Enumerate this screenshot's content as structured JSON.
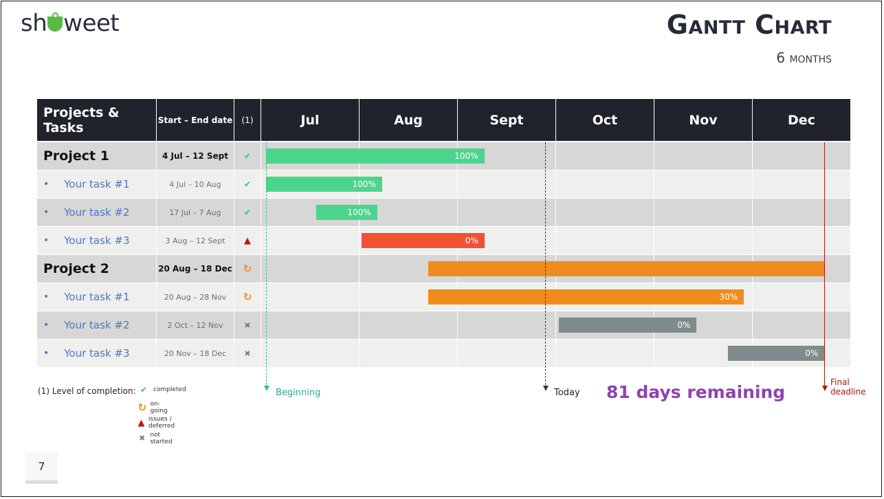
{
  "header": {
    "logo_text": [
      "sh",
      "weet"
    ],
    "title": "Gantt Chart",
    "subtitle": "6 months"
  },
  "table": {
    "col_projects": "Projects & Tasks",
    "col_dates": "Start – End date",
    "col_status": "(1)",
    "months": [
      "Jul",
      "Aug",
      "Sept",
      "Oct",
      "Nov",
      "Dec"
    ]
  },
  "colors": {
    "completed": "#4cd48c",
    "ongoing": "#f08c1e",
    "issues": "#ef5135",
    "not_started": "#7f8b8c",
    "header_bg": "#20232b",
    "row_dark": "#d6d7d6",
    "row_light": "#efefed",
    "beginning": "#2ec27e",
    "today": "#333843",
    "deadline": "#b3140e",
    "remaining": "#8e44ad"
  },
  "chart_data": {
    "type": "gantt",
    "title": "Gantt Chart",
    "subtitle": "6 months",
    "x_axis": {
      "unit": "month",
      "categories": [
        "Jul",
        "Aug",
        "Sept",
        "Oct",
        "Nov",
        "Dec"
      ],
      "range": [
        0,
        6
      ]
    },
    "rows": [
      {
        "kind": "project",
        "name": "Project 1",
        "dates": "4 Jul – 12 Sept",
        "status": "completed",
        "start": 0.05,
        "end": 2.27,
        "progress_label": "100%",
        "bar_color": "completed"
      },
      {
        "kind": "task",
        "name": "Your task #1",
        "dates": "4 Jul – 10 Aug",
        "status": "completed",
        "start": 0.05,
        "end": 1.23,
        "progress_label": "100%",
        "bar_color": "completed"
      },
      {
        "kind": "task",
        "name": "Your task #2",
        "dates": "17 Jul – 7 Aug",
        "status": "completed",
        "start": 0.56,
        "end": 1.18,
        "progress_label": "100%",
        "bar_color": "completed"
      },
      {
        "kind": "task",
        "name": "Your task #3",
        "dates": "3 Aug – 12 Sept",
        "status": "issues",
        "start": 1.02,
        "end": 2.27,
        "progress_label": "0%",
        "bar_color": "issues"
      },
      {
        "kind": "project",
        "name": "Project 2",
        "dates": "20 Aug – 18 Dec",
        "status": "ongoing",
        "start": 1.7,
        "end": 5.73,
        "progress_label": "",
        "bar_color": "ongoing"
      },
      {
        "kind": "task",
        "name": "Your task #1",
        "dates": "20 Aug – 28 Nov",
        "status": "ongoing",
        "start": 1.7,
        "end": 4.91,
        "progress_label": "30%",
        "bar_color": "ongoing"
      },
      {
        "kind": "task",
        "name": "Your task #2",
        "dates": "2 Oct – 12 Nov",
        "status": "not_started",
        "start": 3.03,
        "end": 4.43,
        "progress_label": "0%",
        "bar_color": "not_started"
      },
      {
        "kind": "task",
        "name": "Your task #3",
        "dates": "20 Nov – 18 Dec",
        "status": "not_started",
        "start": 4.75,
        "end": 5.73,
        "progress_label": "0%",
        "bar_color": "not_started"
      }
    ],
    "markers": [
      {
        "name": "beginning",
        "label": "Beginning",
        "at": 0.05
      },
      {
        "name": "today",
        "label": "Today",
        "at": 2.89
      },
      {
        "name": "final-deadline",
        "label": "Final deadline",
        "at": 5.73
      }
    ],
    "annotation": "81 days remaining"
  },
  "legend": {
    "title": "(1) Level of completion:",
    "items": [
      {
        "status": "completed",
        "label": "completed",
        "icon": "check-icon"
      },
      {
        "status": "ongoing",
        "label": "on-going",
        "icon": "refresh-icon"
      },
      {
        "status": "issues",
        "label": "issues / deferred",
        "icon": "warning-icon"
      },
      {
        "status": "not_started",
        "label": "not started",
        "icon": "x-icon"
      }
    ]
  },
  "markers": {
    "beginning": "Beginning",
    "today": "Today",
    "final_deadline_1": "Final",
    "final_deadline_2": "deadline",
    "remaining": "81 days remaining"
  },
  "page_number": "7"
}
